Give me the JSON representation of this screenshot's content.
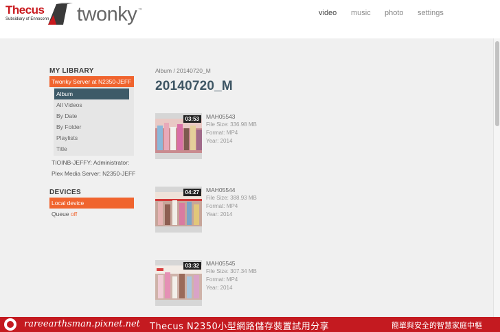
{
  "header": {
    "brand": "Thecus",
    "brand_subtitle": "Subsidiary of Ennoconn",
    "product": "twonky",
    "product_mark": "™",
    "nav": [
      {
        "label": "video",
        "active": true
      },
      {
        "label": "music",
        "active": false
      },
      {
        "label": "photo",
        "active": false
      },
      {
        "label": "settings",
        "active": false
      }
    ]
  },
  "sidebar": {
    "library_title": "MY LIBRARY",
    "server": "Twonky Server at N2350-JEFF",
    "items": [
      "Album",
      "All Videos",
      "By Date",
      "By Folder",
      "Playlists",
      "Title"
    ],
    "active_item": "Album",
    "other_servers": [
      "TIOINB-JEFFY: Administrator:",
      "Plex Media Server: N2350-JEFF"
    ],
    "devices_title": "DEVICES",
    "local_device": "Local device",
    "queue_label": "Queue",
    "queue_state": "off"
  },
  "main": {
    "breadcrumb": "Album / 20140720_M",
    "title": "20140720_M",
    "videos": [
      {
        "name": "MAH05543",
        "duration": "03:53",
        "file_size": "File Size: 336.98 MB",
        "format": "Format: MP4",
        "year": "Year: 2014"
      },
      {
        "name": "MAH05544",
        "duration": "04:27",
        "file_size": "File Size: 388.93 MB",
        "format": "Format: MP4",
        "year": "Year: 2014"
      },
      {
        "name": "MAH05545",
        "duration": "03:32",
        "file_size": "File Size: 307.34 MB",
        "format": "Format: MP4",
        "year": "Year: 2014"
      }
    ]
  },
  "banner": {
    "site": "rareearthsman.pixnet.net",
    "title": "Thecus N2350小型網路儲存裝置試用分享",
    "slogan": "簡單與安全的智慧家庭中樞"
  },
  "colors": {
    "accent": "#f0642e",
    "active_item": "#3d5a68",
    "banner": "#c41a20",
    "brand_red": "#c9191e"
  }
}
